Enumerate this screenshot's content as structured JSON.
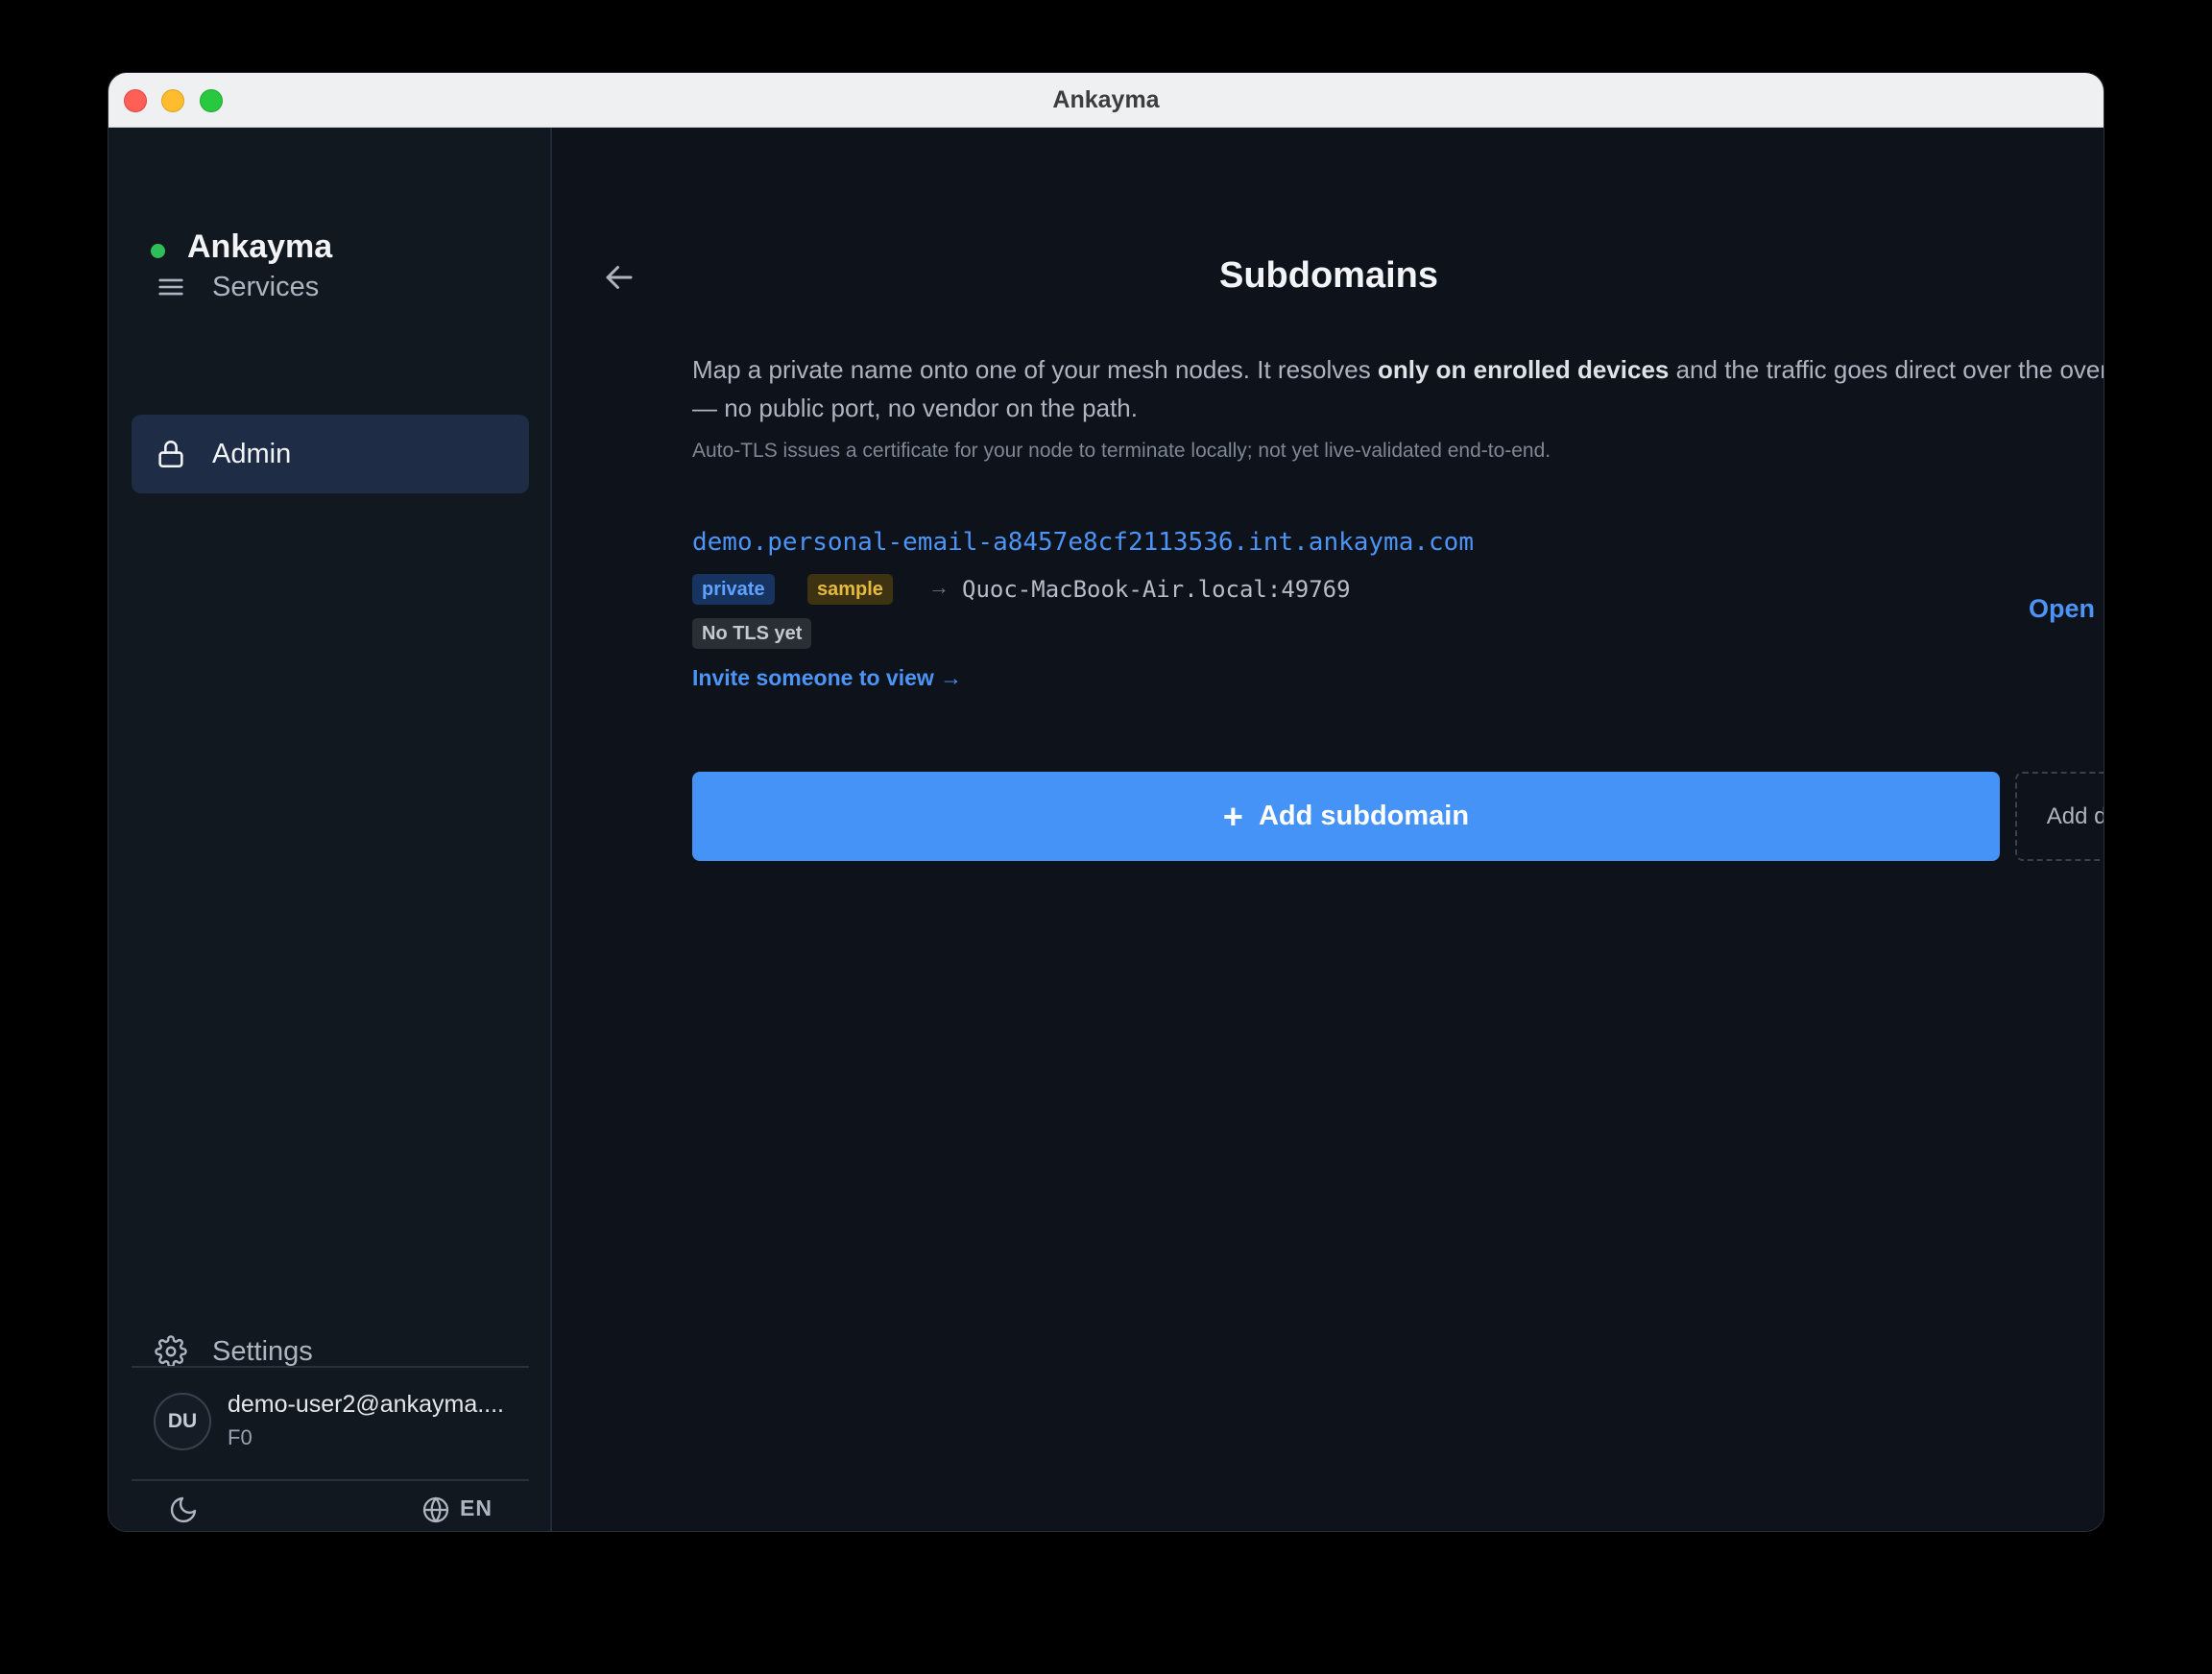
{
  "window": {
    "title": "Ankayma"
  },
  "sidebar": {
    "brand": "Ankayma",
    "status_color": "#2fbf58",
    "items": [
      {
        "label": "Services",
        "icon": "menu-icon",
        "active": false
      },
      {
        "label": "Admin",
        "icon": "lock-icon",
        "active": true
      }
    ],
    "settings_label": "Settings",
    "user": {
      "initials": "DU",
      "email": "demo-user2@ankayma....",
      "sub": "F0"
    },
    "footer": {
      "theme_icon": "moon-icon",
      "lang_icon": "globe-icon",
      "lang": "EN"
    }
  },
  "main": {
    "title": "Subdomains",
    "intro": {
      "before": "Map a private name onto one of your mesh nodes. It resolves ",
      "bold": "only on enrolled devices",
      "after": " and the traffic goes direct over the overlay — no public port, no vendor on the path."
    },
    "note": "Auto-TLS issues a certificate for your node to terminate locally; not yet live-validated end-to-end.",
    "subdomain": {
      "host": "demo.personal-email-a8457e8cf2113536.int.ankayma.com",
      "badges": {
        "private": "private",
        "sample": "sample",
        "tls": "No TLS yet"
      },
      "arrow": "→",
      "target": "Quoc-MacBook-Air.local:49769",
      "invite": "Invite someone to view →",
      "open": "Open"
    },
    "add_button": "Add subdomain",
    "add_demo": "Add demo"
  },
  "colors": {
    "accent": "#4693f7",
    "link": "#4d94f7",
    "background": "#0e121a",
    "sidebar": "#121820"
  }
}
